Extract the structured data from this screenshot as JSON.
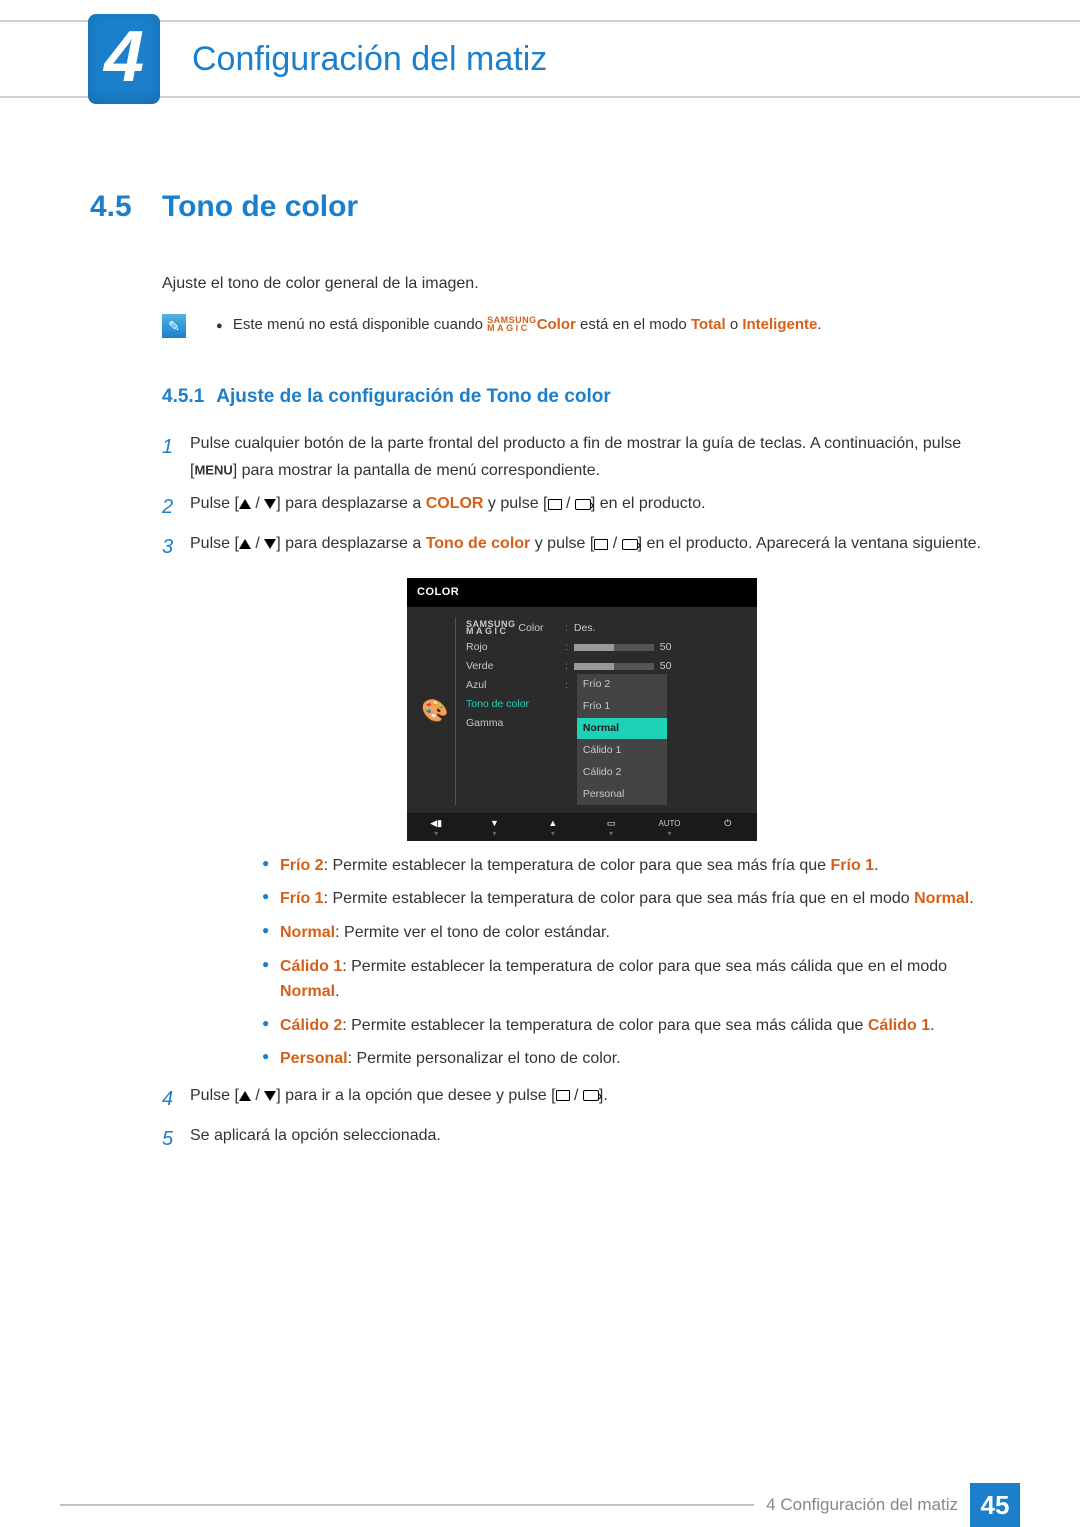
{
  "chapter_number": "4",
  "chapter_title": "Configuración del matiz",
  "section": {
    "number": "4.5",
    "title": "Tono de color"
  },
  "intro_paragraph": "Ajuste el tono de color general de la imagen.",
  "note": {
    "prefix": "Este menú no está disponible cuando ",
    "brand_top": "SAMSUNG",
    "brand_bottom": "MAGIC",
    "color_word": "Color",
    "mid": " está en el modo ",
    "mode_total": "Total",
    "or": " o ",
    "mode_intel": "Inteligente",
    "suffix": "."
  },
  "subsection": {
    "number": "4.5.1",
    "title": "Ajuste de la configuración de Tono de color"
  },
  "steps": {
    "s1": "Pulse cualquier botón de la parte frontal del producto a fin de mostrar la guía de teclas. A continuación, pulse [",
    "s1_menu": "MENU",
    "s1_b": "] para mostrar la pantalla de menú correspondiente.",
    "s2_a": "Pulse [",
    "s2_b": "] para desplazarse a ",
    "s2_color": "COLOR",
    "s2_c": " y pulse [",
    "s2_d": "] en el producto.",
    "s3_a": "Pulse [",
    "s3_b": "] para desplazarse a ",
    "s3_tono": "Tono de color",
    "s3_c": " y pulse [",
    "s3_d": "] en el producto. Aparecerá la ventana siguiente.",
    "s4_a": "Pulse [",
    "s4_b": "] para ir a la opción que desee y pulse [",
    "s4_c": "].",
    "s5": "Se aplicará la opción seleccionada."
  },
  "osd": {
    "title": "COLOR",
    "magic_top": "SAMSUNG",
    "magic_bottom": "MAGIC",
    "magic_color": " Color",
    "rojo": "Rojo",
    "verde": "Verde",
    "azul": "Azul",
    "tono": "Tono de color",
    "gamma": "Gamma",
    "des": "Des.",
    "fifty": "50",
    "options": {
      "frio2": "Frío 2",
      "frio1": "Frío 1",
      "normal": "Normal",
      "calido1": "Cálido 1",
      "calido2": "Cálido 2",
      "personal": "Personal"
    },
    "auto": "AUTO"
  },
  "bullets": {
    "b1_k": "Frío 2",
    "b1_t": ": Permite establecer la temperatura de color para que sea más fría que ",
    "b1_k2": "Frío 1",
    "b1_e": ".",
    "b2_k": "Frío 1",
    "b2_t": ": Permite establecer la temperatura de color para que sea más fría que en el modo ",
    "b2_k2": "Normal",
    "b2_e": ".",
    "b3_k": "Normal",
    "b3_t": ": Permite ver el tono de color estándar.",
    "b4_k": "Cálido 1",
    "b4_t": ": Permite establecer la temperatura de color para que sea más cálida que en el modo ",
    "b4_k2": "Normal",
    "b4_e": ".",
    "b5_k": "Cálido 2",
    "b5_t": ": Permite establecer la temperatura de color para que sea más cálida que ",
    "b5_k2": "Cálido 1",
    "b5_e": ".",
    "b6_k": "Personal",
    "b6_t": ": Permite personalizar el tono de color."
  },
  "footer": {
    "label": "4 Configuración del matiz",
    "page": "45"
  }
}
